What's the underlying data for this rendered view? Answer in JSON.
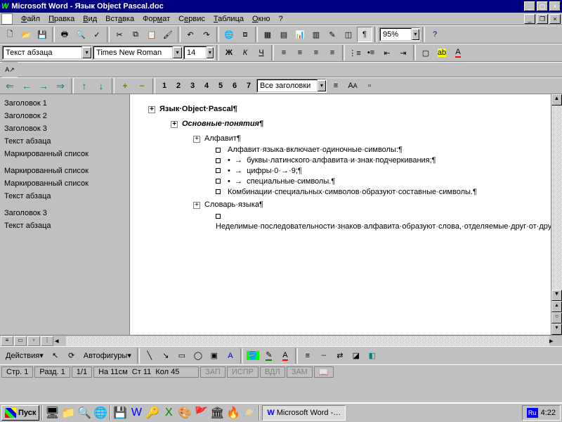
{
  "title": "Microsoft Word - Язык Object Pascal.doc",
  "menu": [
    "Файл",
    "Правка",
    "Вид",
    "Вставка",
    "Формат",
    "Сервис",
    "Таблица",
    "Окно",
    "?"
  ],
  "menu_ul": [
    "Ф",
    "П",
    "В",
    "а",
    "м",
    "е",
    "Т",
    "О",
    "?"
  ],
  "style_combo": "Текст абзаца",
  "font_combo": "Times New Roman",
  "size_combo": "14",
  "zoom_combo": "95%",
  "bold": "Ж",
  "italic": "К",
  "uline": "Ч",
  "ruler_nums": [
    "1",
    "2",
    "3",
    "4",
    "5",
    "6",
    "7"
  ],
  "ruler_label": "Все заголовки",
  "nav": [
    "Заголовок 1",
    "Заголовок 2",
    "Заголовок 3",
    "Текст абзаца",
    "Маркированный список",
    "",
    "Маркированный список",
    "Маркированный список",
    "Текст абзаца",
    "",
    "Заголовок 3",
    "Текст абзаца"
  ],
  "doc": {
    "h1": "Язык·Object·Pascal",
    "h2": "Основные·понятия",
    "h3a": "Алфавит",
    "p1": "Алфавит·языка·включает·одиночные·символы:",
    "b1": "буквы·латинского·алфавита·и·знак·подчеркивания;",
    "b2": "цифры·0·→·9;",
    "b3": "специальные·символы.",
    "p2": "Комбинации·специальных·символов·образуют·составные·символы.",
    "h3b": "Словарь·языка",
    "p3": "Неделимые·последовательности·знаков·алфавита·образуют·слова,·отделяемые·друг·от·друга·разделителями·и·несущие·определенный·смысл·в·программе.·Разделителями·могут·служить·пробел,·символ·конца·строки,·комментарий.·Другие·специальные·символы·и·их·комбинации"
  },
  "draw_actions": "Действия",
  "draw_autoshapes": "Автофигуры",
  "status": {
    "page": "Стр. 1",
    "sect": "Разд. 1",
    "pp": "1/1",
    "at": "На 11см",
    "ln": "Ст 11",
    "col": "Кол 45",
    "modes": [
      "ЗАП",
      "ИСПР",
      "ВДЛ",
      "ЗАМ"
    ]
  },
  "start": "Пуск",
  "task_app": "Microsoft Word -…",
  "lang": "Ru",
  "clock": "4:22"
}
